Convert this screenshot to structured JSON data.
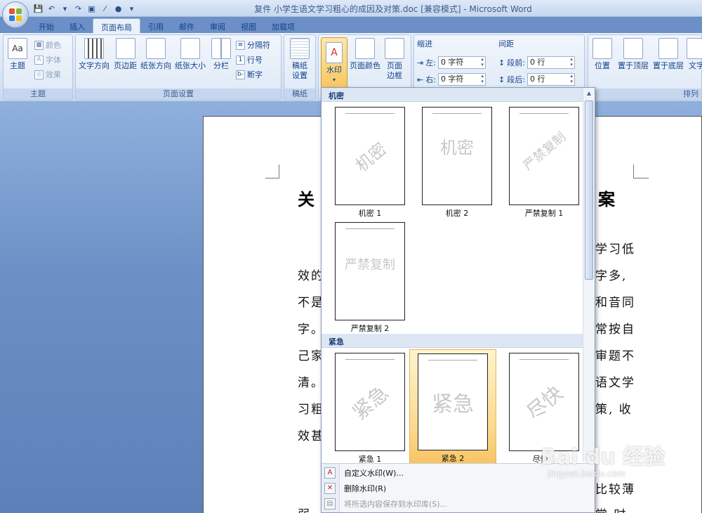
{
  "window": {
    "title": "复件 小学生语文学习粗心的成因及对策.doc [兼容模式] - Microsoft Word"
  },
  "tabs": [
    "开始",
    "插入",
    "页面布局",
    "引用",
    "邮件",
    "审阅",
    "视图",
    "加载项"
  ],
  "active_tab": "页面布局",
  "ribbon": {
    "theme": {
      "label": "主题",
      "big": "主题",
      "colors": "颜色",
      "fonts": "字体",
      "effects": "效果"
    },
    "page_setup": {
      "label": "页面设置",
      "text_direction": "文字方向",
      "margins": "页边距",
      "orientation": "纸张方向",
      "size": "纸张大小",
      "columns": "分栏",
      "breaks": "分隔符",
      "line_numbers": "行号",
      "hyphenation": "断字"
    },
    "draft": {
      "label": "稿纸",
      "btn": "稿纸设置"
    },
    "background": {
      "watermark": "水印",
      "page_color": "页面颜色",
      "page_borders": "页面边框"
    },
    "indent": {
      "label": "缩进",
      "left_label": "左:",
      "left_value": "0 字符",
      "right_label": "右:",
      "right_value": "0 字符"
    },
    "spacing": {
      "label": "间距",
      "before_label": "段前:",
      "before_value": "0 行",
      "after_label": "段后:",
      "after_value": "0 行"
    },
    "arrange": {
      "label": "排列",
      "position": "位置",
      "bring_front": "置于顶层",
      "send_back": "置于底层",
      "wrap": "文字"
    }
  },
  "document": {
    "title_left": "关",
    "title_right": "案",
    "left_chars": [
      "效的",
      "不是",
      "字。",
      "己家",
      "清。",
      "习粗",
      "效甚"
    ],
    "right_chars": [
      "学习低",
      "字多,",
      "和音同",
      "常按自",
      "审题不",
      "语文学",
      "策, 收"
    ],
    "bottom_right": "比较薄",
    "bottom_left": "弱",
    "bottom_right2": "常 时"
  },
  "watermark_gallery": {
    "sections": [
      {
        "name": "机密",
        "items": [
          {
            "caption": "机密 1",
            "text": "机密",
            "diagonal": true
          },
          {
            "caption": "机密 2",
            "text": "机密",
            "diagonal": false
          },
          {
            "caption": "严禁复制 1",
            "text": "严禁复制",
            "diagonal": true
          },
          {
            "caption": "严禁复制 2",
            "text": "严禁复制",
            "diagonal": false
          }
        ]
      },
      {
        "name": "紧急",
        "items": [
          {
            "caption": "紧急 1",
            "text": "紧急",
            "diagonal": true
          },
          {
            "caption": "紧急 2",
            "text": "紧急",
            "diagonal": false,
            "selected": true
          },
          {
            "caption": "尽快 1",
            "text": "尽快",
            "diagonal": true
          }
        ]
      }
    ],
    "menu": [
      {
        "label": "自定义水印(W)...",
        "enabled": true
      },
      {
        "label": "删除水印(R)",
        "enabled": true
      },
      {
        "label": "将所选内容保存到水印库(S)...",
        "enabled": false
      }
    ]
  },
  "site_watermark": {
    "logo": "Bai du 经验",
    "url": "jingyan.baidu.com"
  }
}
